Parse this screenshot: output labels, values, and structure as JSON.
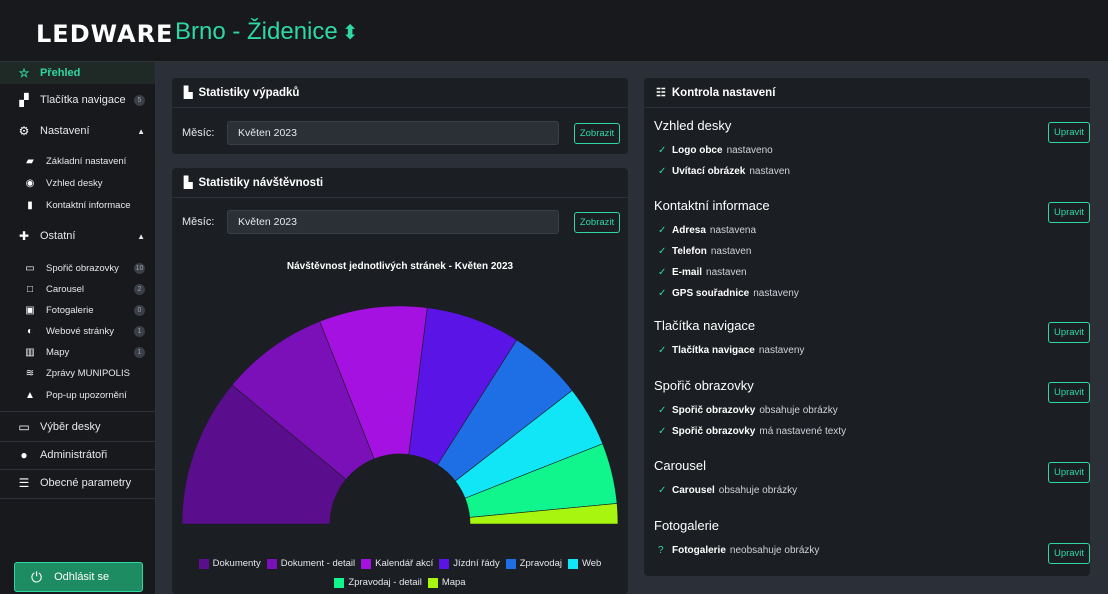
{
  "brand": "LEDWARE",
  "header": {
    "title": "Brno - Židenice",
    "arrow": "⬍"
  },
  "sidebar": {
    "items": [
      {
        "label": "Přehled",
        "icon": "star-icon",
        "glyph": "☆"
      },
      {
        "label": "Tlačítka navigace",
        "icon": "sitemap-icon",
        "glyph": "▞",
        "badge": "5"
      },
      {
        "label": "Nastavení",
        "icon": "gears-icon",
        "glyph": "⚙",
        "caret": "▲"
      },
      {
        "label": "Základní nastavení",
        "icon": "toolbox-icon",
        "glyph": "▰"
      },
      {
        "label": "Vzhled desky",
        "icon": "eye-icon",
        "glyph": "◉"
      },
      {
        "label": "Kontaktní informace",
        "icon": "address-card-icon",
        "glyph": "▮"
      },
      {
        "label": "Ostatní",
        "icon": "puzzle-icon",
        "glyph": "✚",
        "caret": "▲"
      },
      {
        "label": "Spořič obrazovky",
        "icon": "monitor-icon",
        "glyph": "▭",
        "badge": "10"
      },
      {
        "label": "Carousel",
        "icon": "carousel-icon",
        "glyph": "□",
        "badge": "2"
      },
      {
        "label": "Fotogalerie",
        "icon": "image-icon",
        "glyph": "▣",
        "badge": "0"
      },
      {
        "label": "Webové stránky",
        "icon": "globe-icon",
        "glyph": "◐",
        "badge": "1"
      },
      {
        "label": "Mapy",
        "icon": "map-icon",
        "glyph": "▥",
        "badge": "1"
      },
      {
        "label": "Zprávy MUNIPOLIS",
        "icon": "rss-icon",
        "glyph": "≋"
      },
      {
        "label": "Pop-up upozornění",
        "icon": "bell-icon",
        "glyph": "▲"
      },
      {
        "label": "Výběr desky",
        "icon": "desktop-icon",
        "glyph": "▭"
      },
      {
        "label": "Administrátoři",
        "icon": "user-icon",
        "glyph": "●"
      },
      {
        "label": "Obecné parametry",
        "icon": "list-icon",
        "glyph": "☰"
      }
    ],
    "logout": "Odhlásit se"
  },
  "outages": {
    "title": "Statistiky výpadků",
    "month_label": "Měsíc:",
    "month_value": "Květen 2023",
    "show": "Zobrazit"
  },
  "visits": {
    "title": "Statistiky návštěvnosti",
    "month_label": "Měsíc:",
    "month_value": "Květen 2023",
    "show": "Zobrazit"
  },
  "chart_data": {
    "type": "pie",
    "title": "Návštěvnost jednotlivých stránek - Květen 2023",
    "categories": [
      "Dokumenty",
      "Dokument - detail",
      "Kalendář akcí",
      "Jízdní řády",
      "Zpravodaj",
      "Web",
      "Zpravodaj - detail",
      "Mapa"
    ],
    "values": [
      22,
      16,
      16,
      14,
      11,
      9,
      9,
      3
    ],
    "colors": [
      "#5a0d8c",
      "#7b0fb8",
      "#a511e0",
      "#5a14e6",
      "#1e6fe6",
      "#10e6f5",
      "#10f58c",
      "#a8f510"
    ],
    "shape": "half-donut"
  },
  "settings": {
    "title": "Kontrola nastavení",
    "edit": "Upravit",
    "sections": [
      {
        "title": "Vzhled desky",
        "checks": [
          {
            "mark": "✓",
            "bold": "Logo obce",
            "rest": "nastaveno"
          },
          {
            "mark": "✓",
            "bold": "Uvítací obrázek",
            "rest": "nastaven"
          }
        ]
      },
      {
        "title": "Kontaktní informace",
        "checks": [
          {
            "mark": "✓",
            "bold": "Adresa",
            "rest": "nastavena"
          },
          {
            "mark": "✓",
            "bold": "Telefon",
            "rest": "nastaven"
          },
          {
            "mark": "✓",
            "bold": "E-mail",
            "rest": "nastaven"
          },
          {
            "mark": "✓",
            "bold": "GPS souřadnice",
            "rest": "nastaveny"
          }
        ]
      },
      {
        "title": "Tlačítka navigace",
        "checks": [
          {
            "mark": "✓",
            "bold": "Tlačítka navigace",
            "rest": "nastaveny"
          }
        ]
      },
      {
        "title": "Spořič obrazovky",
        "checks": [
          {
            "mark": "✓",
            "bold": "Spořič obrazovky",
            "rest": "obsahuje obrázky"
          },
          {
            "mark": "✓",
            "bold": "Spořič obrazovky",
            "rest": "má nastavené texty"
          }
        ]
      },
      {
        "title": "Carousel",
        "checks": [
          {
            "mark": "✓",
            "bold": "Carousel",
            "rest": "obsahuje obrázky"
          }
        ]
      },
      {
        "title": "Fotogalerie",
        "checks": [
          {
            "mark": "?",
            "bold": "Fotogalerie",
            "rest": "neobsahuje obrázky"
          }
        ]
      }
    ]
  },
  "colors": {
    "accent": "#2fd8a2",
    "bg": "#2b3038",
    "panel": "#1b1e23"
  }
}
